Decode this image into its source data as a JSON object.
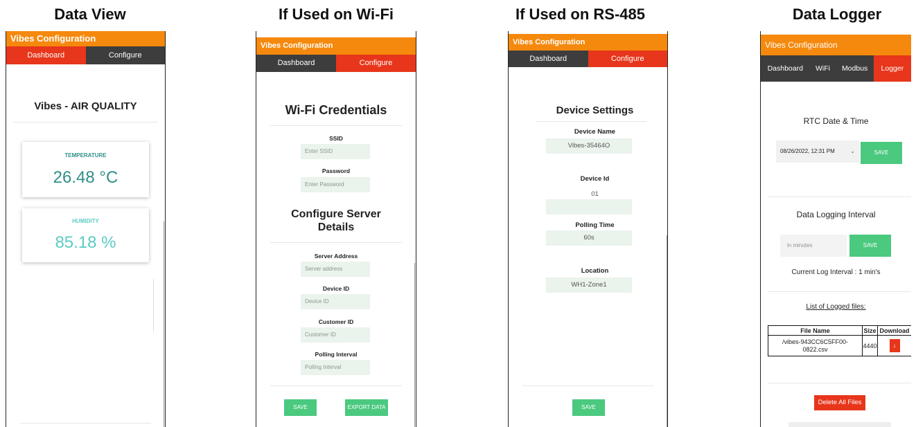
{
  "panels": [
    {
      "title": "Data View"
    },
    {
      "title": "If Used on Wi-Fi"
    },
    {
      "title": "If Used on RS-485"
    },
    {
      "title": "Data Logger"
    }
  ],
  "app_title": "Vibes Configuration",
  "colors": {
    "orange": "#f5890d",
    "red": "#e7361b",
    "dark": "#3d3d3d",
    "green": "#4bc97f",
    "teal": "#2e8f88",
    "light_teal": "#5ccbc4"
  },
  "data_view": {
    "tabs": [
      "Dashboard",
      "Configure"
    ],
    "heading": "Vibes - AIR QUALITY",
    "temperature": {
      "label": "TEMPERATURE",
      "value": "26.48 °C"
    },
    "humidity": {
      "label": "HUMIDITY",
      "value": "85.18 %"
    }
  },
  "wifi": {
    "tabs": [
      "Dashboard",
      "Configure"
    ],
    "heading": "Wi-Fi Credentials",
    "ssid": {
      "label": "SSID",
      "placeholder": "Enter SSID"
    },
    "password": {
      "label": "Password",
      "placeholder": "Enter Password"
    },
    "server_heading_1": "Configure Server",
    "server_heading_2": "Details",
    "server_address": {
      "label": "Server Address",
      "placeholder": "Server address"
    },
    "device_id": {
      "label": "Device ID",
      "placeholder": "Device ID"
    },
    "customer_id": {
      "label": "Customer ID",
      "placeholder": "Customer ID"
    },
    "polling_interval": {
      "label": "Polling Interval",
      "placeholder": "Polling Interval"
    },
    "save": "SAVE",
    "export": "EXPORT DATA"
  },
  "rs485": {
    "tabs": [
      "Dashboard",
      "Configure"
    ],
    "heading": "Device Settings",
    "device_name": {
      "label": "Device Name",
      "value": "Vibes-35464O"
    },
    "device_id": {
      "label": "Device Id",
      "value": "01"
    },
    "polling_time": {
      "label": "Polling Time",
      "value": "60s"
    },
    "location": {
      "label": "Location",
      "value": "WH1-Zone1"
    },
    "save": "SAVE"
  },
  "logger": {
    "tabs": [
      "Dashboard",
      "WiFi",
      "Modbus",
      "Logger"
    ],
    "rtc_heading": "RTC Date & Time",
    "rtc_value": "08/26/2022, 12:31 PM",
    "save": "SAVE",
    "interval_heading": "Data Logging Interval",
    "interval_placeholder": "in minutes",
    "current_interval": "Current Log Interval : 1 min's",
    "files_heading": "List of Logged files:",
    "table_headers": [
      "File Name",
      "Size",
      "Download"
    ],
    "file_row": {
      "name_line1": "/vibes-943CC6C5FF00-",
      "name_line2": "0822.csv",
      "size": "4440"
    },
    "delete_all": "Delete All Files"
  }
}
